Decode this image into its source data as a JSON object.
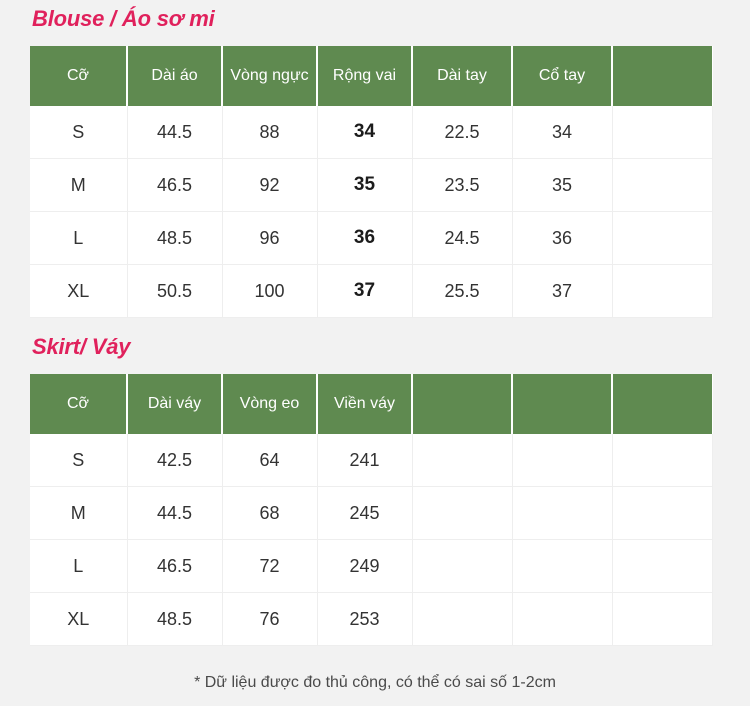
{
  "page": {
    "background_color": "#f2f2f2",
    "accent_title_color": "#e0215c",
    "header_color": "#5f8a50"
  },
  "sections": [
    {
      "title": "Blouse / Áo sơ mi",
      "headers": [
        "Cỡ",
        "Dài áo",
        "Vòng ngực",
        "Rộng vai",
        "Dài tay",
        "Cổ tay",
        ""
      ],
      "emphasis_column": 3,
      "rows": [
        [
          "S",
          "44.5",
          "88",
          "34",
          "22.5",
          "34",
          ""
        ],
        [
          "M",
          "46.5",
          "92",
          "35",
          "23.5",
          "35",
          ""
        ],
        [
          "L",
          "48.5",
          "96",
          "36",
          "24.5",
          "36",
          ""
        ],
        [
          "XL",
          "50.5",
          "100",
          "37",
          "25.5",
          "37",
          ""
        ]
      ]
    },
    {
      "title": "Skirt/ Váy",
      "headers": [
        "Cỡ",
        "Dài váy",
        "Vòng eo",
        "Viền váy",
        "",
        "",
        ""
      ],
      "emphasis_column": -1,
      "rows": [
        [
          "S",
          "42.5",
          "64",
          "241",
          "",
          "",
          ""
        ],
        [
          "M",
          "44.5",
          "68",
          "245",
          "",
          "",
          ""
        ],
        [
          "L",
          "46.5",
          "72",
          "249",
          "",
          "",
          ""
        ],
        [
          "XL",
          "48.5",
          "76",
          "253",
          "",
          "",
          ""
        ]
      ]
    }
  ],
  "footnote": "* Dữ liệu được đo thủ công, có thể có sai số 1-2cm"
}
